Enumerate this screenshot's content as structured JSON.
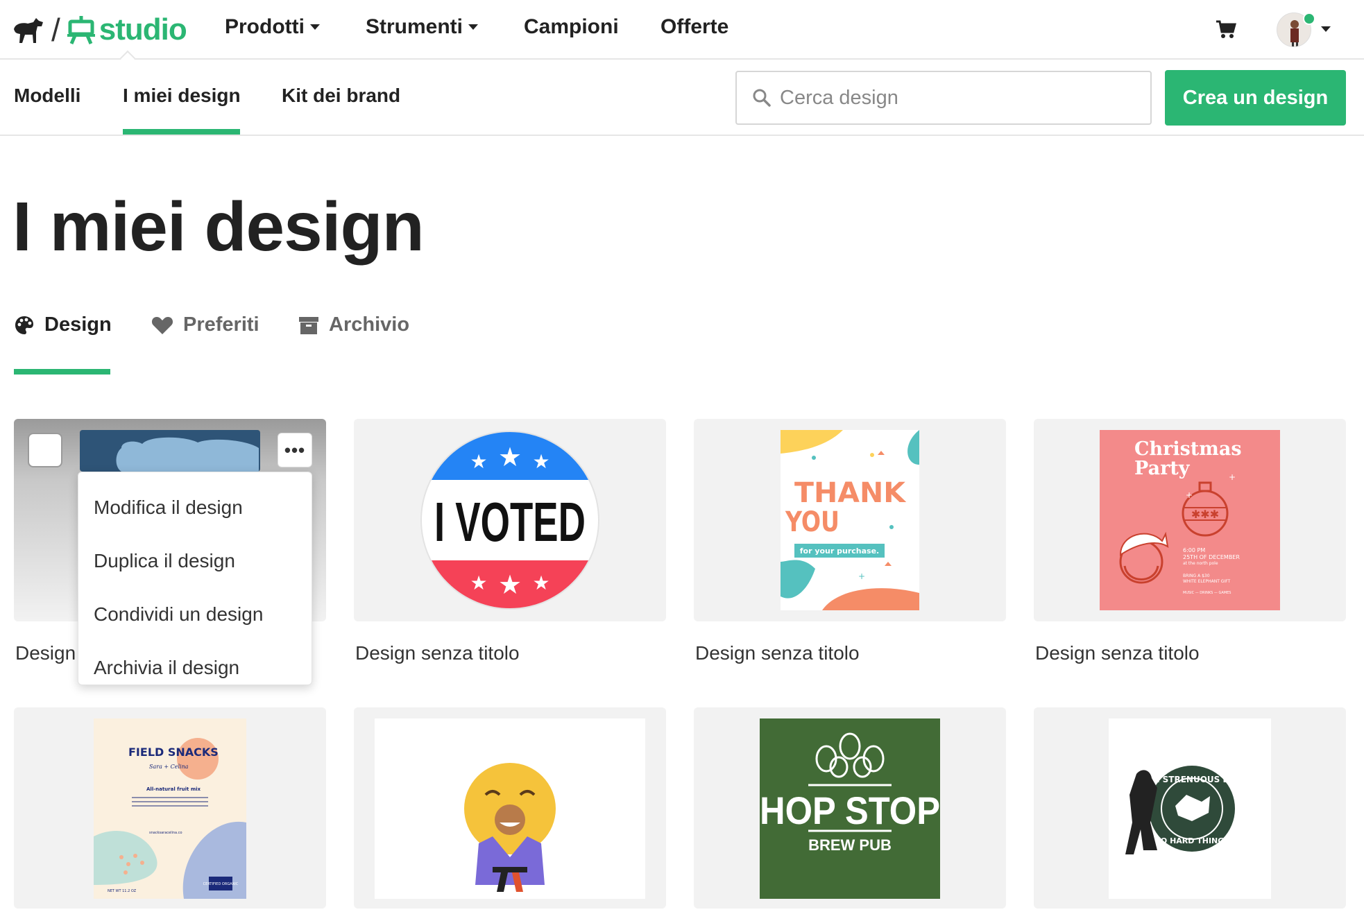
{
  "topnav": {
    "logo_text": "studio",
    "items": [
      {
        "label": "Prodotti",
        "has_dropdown": true
      },
      {
        "label": "Strumenti",
        "has_dropdown": true
      },
      {
        "label": "Campioni",
        "has_dropdown": false
      },
      {
        "label": "Offerte",
        "has_dropdown": false
      }
    ],
    "cart_icon": "cart-icon",
    "avatar_status_color": "#2bb673"
  },
  "subnav": {
    "items": [
      {
        "label": "Modelli"
      },
      {
        "label": "I miei design",
        "active": true
      },
      {
        "label": "Kit dei brand"
      }
    ],
    "search_placeholder": "Cerca design",
    "search_value": "",
    "create_label": "Crea un design"
  },
  "page": {
    "title": "I miei design",
    "tabs": [
      {
        "label": "Design",
        "icon": "palette-icon",
        "active": true
      },
      {
        "label": "Preferiti",
        "icon": "heart-icon",
        "active": false
      },
      {
        "label": "Archivio",
        "icon": "archive-icon",
        "active": false
      }
    ]
  },
  "designs": [
    {
      "caption": "Design",
      "thumb": "blue-clouds"
    },
    {
      "caption": "Design senza titolo",
      "thumb": "i-voted",
      "text": "I VOTED"
    },
    {
      "caption": "Design senza titolo",
      "thumb": "thank-you",
      "text_main": "THANK YOU",
      "text_sub": "for your purchase."
    },
    {
      "caption": "Design senza titolo",
      "thumb": "christmas-party",
      "text_main": "Christmas Party",
      "text_date": "6:00 PM",
      "text_day": "25TH OF DECEMBER",
      "text_place": "at the north pole",
      "text_bring": "BRING A $30",
      "text_gift": "WHITE ELEPHANT GIFT",
      "text_footer": "MUSIC — DRINKS — GAMES"
    },
    {
      "caption": "",
      "thumb": "field-snacks",
      "text_main": "FIELD SNACKS",
      "text_script": "Sara + Celina",
      "text_sub": "All-natural fruit mix",
      "text_desc": "This pack provides a balanced source of nutrition, often combining healthy fats, protein, and complex carbohydrates.",
      "text_url": "snacksaracelina.co",
      "text_weight": "NET WT 11.2 OZ",
      "text_badge": "CERTIFIED ORGANIC"
    },
    {
      "caption": "",
      "thumb": "emoji-karate"
    },
    {
      "caption": "",
      "thumb": "hop-stop",
      "text_main": "HOP STOP",
      "text_sub": "BREW PUB"
    },
    {
      "caption": "",
      "thumb": "strenuous-life",
      "text_main": "THE STRENUOUS LIFE",
      "text_sub": "DO HARD THINGS"
    }
  ],
  "context_menu": {
    "items": [
      {
        "label": "Modifica il design"
      },
      {
        "label": "Duplica il design"
      },
      {
        "label": "Condividi un design"
      },
      {
        "label": "Archivia il design"
      }
    ]
  },
  "colors": {
    "accent": "#2bb673",
    "text": "#222222",
    "card_bg": "#f2f2f2"
  }
}
